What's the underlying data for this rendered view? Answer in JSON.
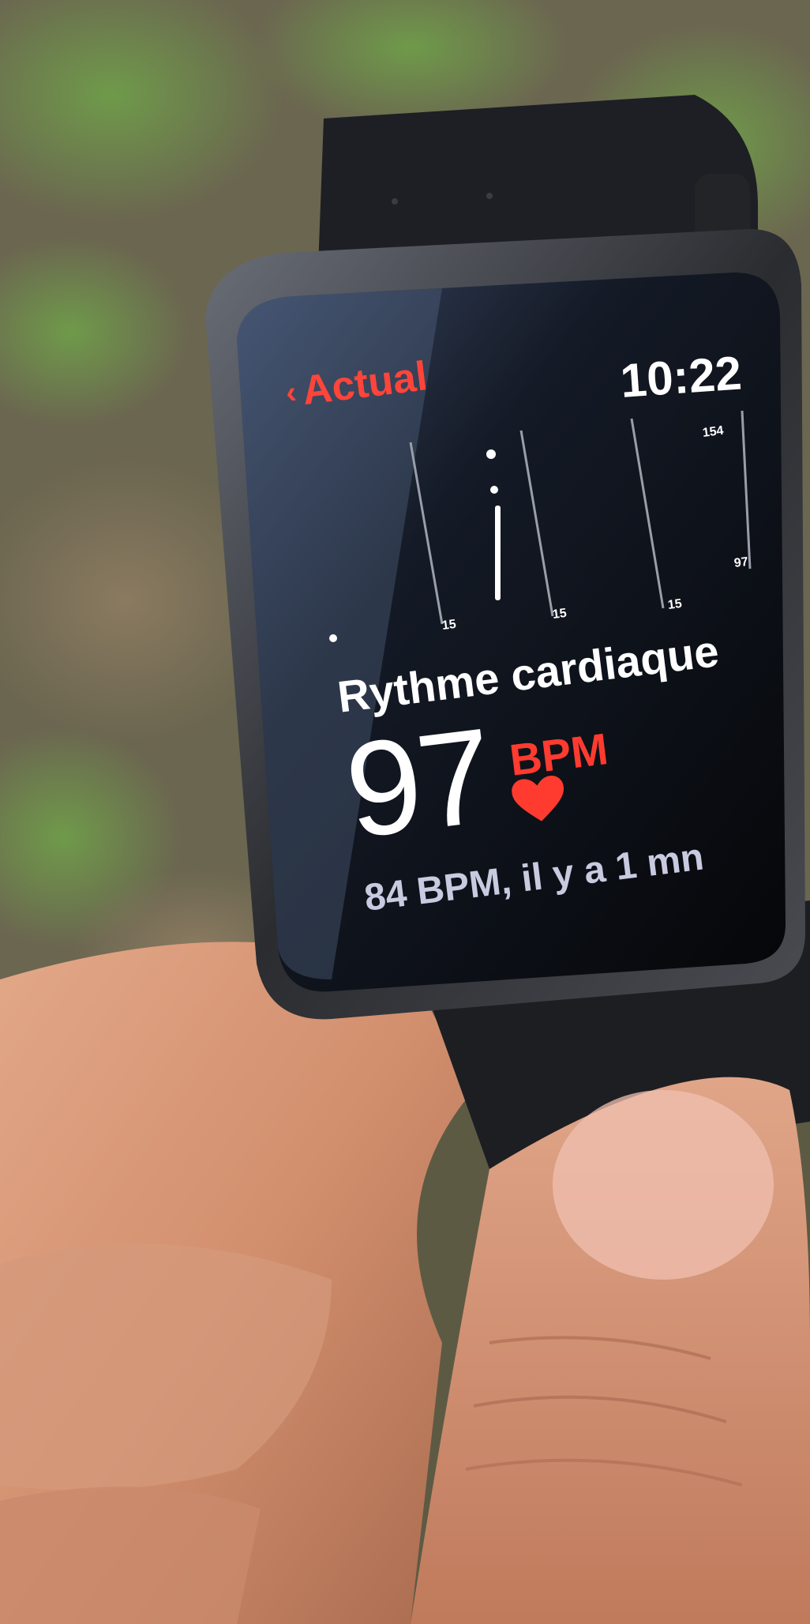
{
  "watch_screen": {
    "back_label": "Actual",
    "time": "10:22",
    "heart_rate_title": "Rythme cardiaque",
    "current_bpm": "97",
    "bpm_unit": "BPM",
    "previous_reading": "84 BPM, il y a 1 mn",
    "accent_color": "#ff3b30",
    "icons": [
      "chevron-left-icon",
      "heart-icon"
    ]
  },
  "chart_data": {
    "type": "range",
    "y_tick_labels": [
      "154",
      "97"
    ],
    "x_tick_labels": [
      "15",
      "15",
      "15"
    ]
  }
}
